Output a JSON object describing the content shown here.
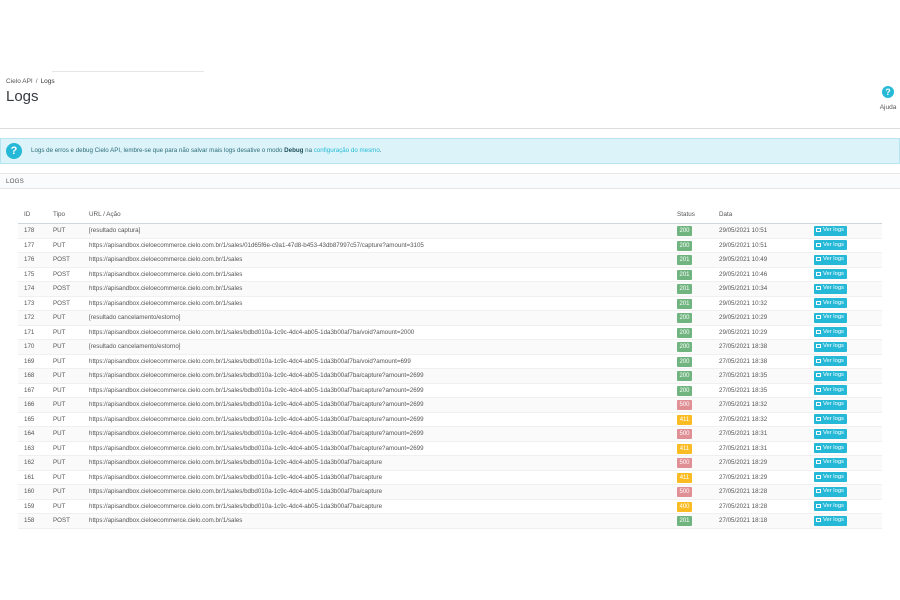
{
  "breadcrumb": {
    "parent": "Cielo API",
    "separator": "/",
    "current": "Logs"
  },
  "page_title": "Logs",
  "help": {
    "label": "Ajuda",
    "icon": "question-icon"
  },
  "alert": {
    "icon": "question-icon",
    "text_before": "Logs de erros e debug Cielo API, lembre-se que para não salvar mais logs desative o modo ",
    "bold": "Debug",
    "text_middle": " na ",
    "link": "configuração do mesmo",
    "text_after": "."
  },
  "panel": {
    "title": "LOGS"
  },
  "columns": {
    "id": "ID",
    "type": "Tipo",
    "url": "URL / Ação",
    "status": "Status",
    "date": "Data"
  },
  "colors": {
    "accent": "#25b9d7",
    "status_ok": "#70b580",
    "status_error": "#e08f95",
    "status_warn": "#fbbb22"
  },
  "rows": [
    {
      "id": "178",
      "type": "PUT",
      "url": "[resultado captura]",
      "status": "200",
      "status_class": "green",
      "date": "29/05/2021 10:51",
      "action": "Ver logs"
    },
    {
      "id": "177",
      "type": "PUT",
      "url": "https://apisandbox.cieloecommerce.cielo.com.br/1/sales/01d65f6e-c9a1-47d8-b453-43db87997c57/capture?amount=3105",
      "status": "200",
      "status_class": "green",
      "date": "29/05/2021 10:51",
      "action": "Ver logs"
    },
    {
      "id": "176",
      "type": "POST",
      "url": "https://apisandbox.cieloecommerce.cielo.com.br/1/sales",
      "status": "201",
      "status_class": "green",
      "date": "29/05/2021 10:49",
      "action": "Ver logs"
    },
    {
      "id": "175",
      "type": "POST",
      "url": "https://apisandbox.cieloecommerce.cielo.com.br/1/sales",
      "status": "201",
      "status_class": "green",
      "date": "29/05/2021 10:46",
      "action": "Ver logs"
    },
    {
      "id": "174",
      "type": "POST",
      "url": "https://apisandbox.cieloecommerce.cielo.com.br/1/sales",
      "status": "201",
      "status_class": "green",
      "date": "29/05/2021 10:34",
      "action": "Ver logs"
    },
    {
      "id": "173",
      "type": "POST",
      "url": "https://apisandbox.cieloecommerce.cielo.com.br/1/sales",
      "status": "201",
      "status_class": "green",
      "date": "29/05/2021 10:32",
      "action": "Ver logs"
    },
    {
      "id": "172",
      "type": "PUT",
      "url": "[resultado cancelamento/estorno]",
      "status": "200",
      "status_class": "green",
      "date": "29/05/2021 10:29",
      "action": "Ver logs"
    },
    {
      "id": "171",
      "type": "PUT",
      "url": "https://apisandbox.cieloecommerce.cielo.com.br/1/sales/bdbd010a-1c9c-4dc4-ab05-1da3b00af7ba/void?amount=2000",
      "status": "200",
      "status_class": "green",
      "date": "29/05/2021 10:29",
      "action": "Ver logs"
    },
    {
      "id": "170",
      "type": "PUT",
      "url": "[resultado cancelamento/estorno]",
      "status": "200",
      "status_class": "green",
      "date": "27/05/2021 18:38",
      "action": "Ver logs"
    },
    {
      "id": "169",
      "type": "PUT",
      "url": "https://apisandbox.cieloecommerce.cielo.com.br/1/sales/bdbd010a-1c9c-4dc4-ab05-1da3b00af7ba/void?amount=699",
      "status": "200",
      "status_class": "green",
      "date": "27/05/2021 18:38",
      "action": "Ver logs"
    },
    {
      "id": "168",
      "type": "PUT",
      "url": "https://apisandbox.cieloecommerce.cielo.com.br/1/sales/bdbd010a-1c9c-4dc4-ab05-1da3b00af7ba/capture?amount=2699",
      "status": "200",
      "status_class": "green",
      "date": "27/05/2021 18:35",
      "action": "Ver logs"
    },
    {
      "id": "167",
      "type": "PUT",
      "url": "https://apisandbox.cieloecommerce.cielo.com.br/1/sales/bdbd010a-1c9c-4dc4-ab05-1da3b00af7ba/capture?amount=2699",
      "status": "200",
      "status_class": "green",
      "date": "27/05/2021 18:35",
      "action": "Ver logs"
    },
    {
      "id": "166",
      "type": "PUT",
      "url": "https://apisandbox.cieloecommerce.cielo.com.br/1/sales/bdbd010a-1c9c-4dc4-ab05-1da3b00af7ba/capture?amount=2699",
      "status": "500",
      "status_class": "red",
      "date": "27/05/2021 18:32",
      "action": "Ver logs"
    },
    {
      "id": "165",
      "type": "PUT",
      "url": "https://apisandbox.cieloecommerce.cielo.com.br/1/sales/bdbd010a-1c9c-4dc4-ab05-1da3b00af7ba/capture?amount=2699",
      "status": "411",
      "status_class": "orange",
      "date": "27/05/2021 18:32",
      "action": "Ver logs"
    },
    {
      "id": "164",
      "type": "PUT",
      "url": "https://apisandbox.cieloecommerce.cielo.com.br/1/sales/bdbd010a-1c9c-4dc4-ab05-1da3b00af7ba/capture?amount=2699",
      "status": "500",
      "status_class": "red",
      "date": "27/05/2021 18:31",
      "action": "Ver logs"
    },
    {
      "id": "163",
      "type": "PUT",
      "url": "https://apisandbox.cieloecommerce.cielo.com.br/1/sales/bdbd010a-1c9c-4dc4-ab05-1da3b00af7ba/capture?amount=2699",
      "status": "411",
      "status_class": "orange",
      "date": "27/05/2021 18:31",
      "action": "Ver logs"
    },
    {
      "id": "162",
      "type": "PUT",
      "url": "https://apisandbox.cieloecommerce.cielo.com.br/1/sales/bdbd010a-1c9c-4dc4-ab05-1da3b00af7ba/capture",
      "status": "500",
      "status_class": "red",
      "date": "27/05/2021 18:29",
      "action": "Ver logs"
    },
    {
      "id": "161",
      "type": "PUT",
      "url": "https://apisandbox.cieloecommerce.cielo.com.br/1/sales/bdbd010a-1c9c-4dc4-ab05-1da3b00af7ba/capture",
      "status": "411",
      "status_class": "orange",
      "date": "27/05/2021 18:29",
      "action": "Ver logs"
    },
    {
      "id": "160",
      "type": "PUT",
      "url": "https://apisandbox.cieloecommerce.cielo.com.br/1/sales/bdbd010a-1c9c-4dc4-ab05-1da3b00af7ba/capture",
      "status": "500",
      "status_class": "red",
      "date": "27/05/2021 18:28",
      "action": "Ver logs"
    },
    {
      "id": "159",
      "type": "PUT",
      "url": "https://apisandbox.cieloecommerce.cielo.com.br/1/sales/bdbd010a-1c9c-4dc4-ab05-1da3b00af7ba/capture",
      "status": "400",
      "status_class": "orange",
      "date": "27/05/2021 18:28",
      "action": "Ver logs"
    },
    {
      "id": "158",
      "type": "POST",
      "url": "https://apisandbox.cieloecommerce.cielo.com.br/1/sales",
      "status": "201",
      "status_class": "green",
      "date": "27/05/2021 18:18",
      "action": "Ver logs"
    }
  ]
}
